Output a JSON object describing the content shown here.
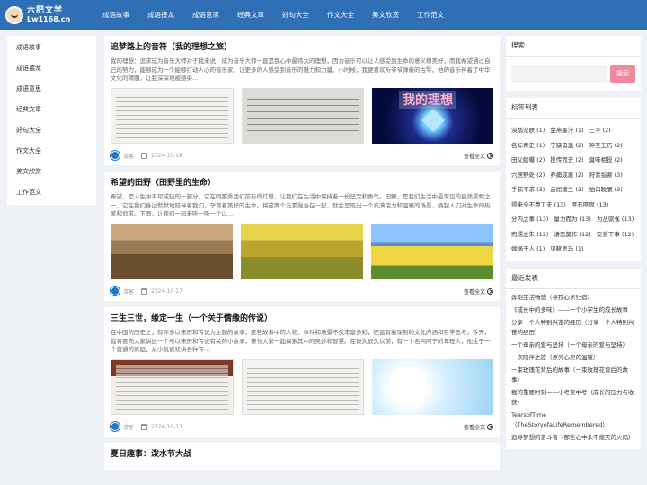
{
  "logo": {
    "line1": "六肥文学",
    "line2": "Lw1168.cn"
  },
  "nav": [
    "成语故事",
    "成语接龙",
    "成语意思",
    "经典文章",
    "好句大全",
    "作文大全",
    "美文欣赏",
    "工作范文"
  ],
  "leftnav": [
    "成语故事",
    "成语接龙",
    "成语意思",
    "经典文章",
    "好句大全",
    "作文大全",
    "美文欣赏",
    "工作范文"
  ],
  "articles": [
    {
      "title": "追梦路上的音符（我的理想之旅）",
      "excerpt": "我的理想：追求成为音乐大师对于我来说，成为音乐大师一直是我心中最伟大的理想，因为音乐可以让人感受到生命的意义和美好，而我希望通过自己的努力，能够成为一个能够打动人心的音乐家，让更多的人感受到音乐的魅力和力量。小时候，我便喜欢听爷爷弹奏的古琴，他的音乐伴着了中华文化的精髓，让我深深地被感染...",
      "author": "游客",
      "date": "2024-10-18",
      "more": "查看全文",
      "dream_text": "我的理想"
    },
    {
      "title": "希望的田野（田野里的生命）",
      "excerpt": "希望，是人生中不可或缺的一部分，它在同那秀我们前行的灯塔，让我们在生活中保持着一份坚定和勇气。田野，是我们生活中最常见的自然景观之一，它在我们身边默默地陪伴着我们，孕育着美好的生命。将这两个元素融合在一起，就会呈现出一个充满活力和温暖的场景，唤起人们对生命的热爱和追求。下面，让我们一起来听一听一个以...",
      "author": "游客",
      "date": "2024-10-17",
      "more": "查看全文"
    },
    {
      "title": "三生三世，缘定一生（一个关于情缘的传说）",
      "excerpt": "在中国的历史上，有许多以来历和传说为主题的故事，这些故事中的人物、事件和场景不仅丰富多彩，还富有着深刻的文化内涵和哲学思考。今天，我将要向大家讲述一个与以来历和传说有关的小故事，带领大家一起探索其中的奥妙和智慧。在很久很久以前，有一个名叫阿宁的年轻人，他生于一个普通的家庭，从小就喜欢讲各种传...",
      "author": "游客",
      "date": "2024-10-17",
      "more": "查看全文"
    },
    {
      "title": "夏日趣事：泼水节大战"
    }
  ],
  "search": {
    "title": "搜索",
    "button": "搜索",
    "placeholder": ""
  },
  "tags": {
    "title": "标签列表",
    "items": [
      "泱翁沦肤 (1)",
      "金燕墨汁 (1)",
      "三字 (2)",
      "名标青史 (1)",
      "宁缺毋滥 (2)",
      "神圣工巧 (2)",
      "田父献曝 (2)",
      "投传而去 (2)",
      "臭味相投 (2)",
      "穴居野处 (2)",
      "养痈成患 (2)",
      "狩青指索 (3)",
      "手软不求 (3)",
      "云屈灌兰 (3)",
      "抽口耽腮 (3)",
      "得来全不费工夫 (13)",
      "匪石匪席 (13)",
      "分内之事 (13)",
      "量力而为 (13)",
      "为丛驱雀 (13)",
      "煦濡之朱 (12)",
      "请思莫作 (12)",
      "安贫下事 (12)",
      "嫁祸于人 (1)",
      "见靴思马 (1)"
    ]
  },
  "recent": {
    "title": "最近发表",
    "items": [
      "奔跑生活畅想（寻找心灵归宿）",
      "《成长中的多味》——一个小学生的成长故事",
      "分享一个人特别兴奋的经历（分享一个人特别兴奋的经历）",
      "一个母亲的爱与坚持（一个母亲的爱与坚持）",
      "一次陪伴之旅（点亮心灵的温暖）",
      "一束玫瑰花背后的故事（一束玫瑰花背后的故事）",
      "我的重要时刻——小考变中考（成长的压力与收获）",
      "TearsofTime（TheStoryofaLifeRemembered）",
      "追寻梦想的奋斗者（那些心中永不熄灭的火焰）"
    ]
  },
  "colors": {
    "nav": "#2f6fb5",
    "search_button": "#f08a9a",
    "background": "#eef2f6"
  }
}
